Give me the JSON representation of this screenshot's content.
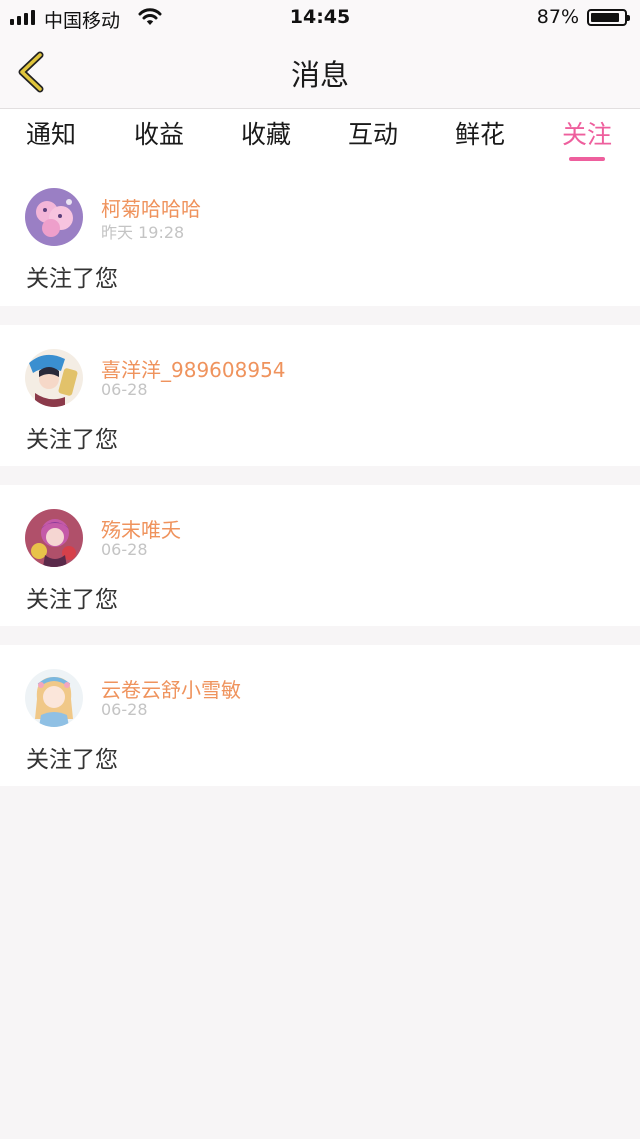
{
  "status_bar": {
    "carrier": "中国移动",
    "time": "14:45",
    "battery_percent": "87%",
    "battery_level": 0.87,
    "icons": [
      "signal-icon",
      "wifi-icon",
      "battery-icon"
    ]
  },
  "header": {
    "title": "消息",
    "back_icon": "chevron-left-icon"
  },
  "tabs": [
    {
      "label": "通知",
      "active": false
    },
    {
      "label": "收益",
      "active": false
    },
    {
      "label": "收藏",
      "active": false
    },
    {
      "label": "互动",
      "active": false
    },
    {
      "label": "鲜花",
      "active": false
    },
    {
      "label": "关注",
      "active": true
    }
  ],
  "messages": [
    {
      "username": "柯菊哈哈哈",
      "date": "昨天 19:28",
      "text": "关注了您"
    },
    {
      "username": "喜洋洋_989608954",
      "date": "06-28",
      "text": "关注了您"
    },
    {
      "username": "殇末唯夭",
      "date": "06-28",
      "text": "关注了您"
    },
    {
      "username": "云卷云舒小雪敏",
      "date": "06-28",
      "text": "关注了您"
    }
  ],
  "colors": {
    "accent": "#ee5f9d",
    "username": "#ef935d",
    "date": "#c4c4c4",
    "back_chevron": "#e0c53c",
    "page_background": "#f7f5f6"
  }
}
